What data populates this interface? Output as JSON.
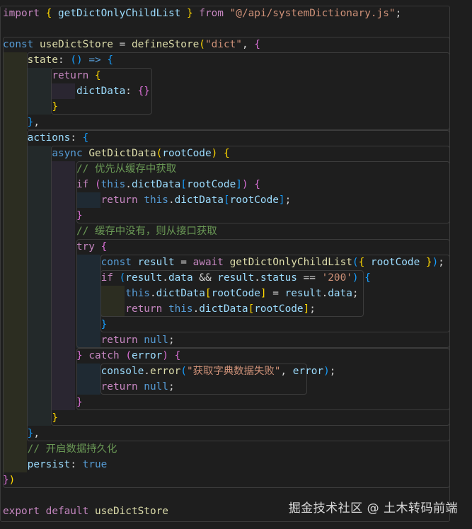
{
  "code": {
    "import_kw": "import",
    "import_name": "getDictOnlyChildList",
    "from_kw": "from",
    "import_path": "\"@/api/systemDictionary.js\"",
    "const_kw": "const",
    "store_name": "useDictStore",
    "define_fn": "defineStore",
    "store_id": "\"dict\"",
    "state_key": "state",
    "return_kw": "return",
    "dict_data_prop": "dictData",
    "actions_key": "actions",
    "async_kw": "async",
    "method_name": "GetDictData",
    "param_root_code": "rootCode",
    "comment_cache": "// 优先从缓存中获取",
    "if_kw": "if",
    "this_kw": "this",
    "comment_no_cache": "// 缓存中没有，则从接口获取",
    "try_kw": "try",
    "result_var": "result",
    "await_kw": "await",
    "data_prop": "data",
    "status_prop": "status",
    "status_value": "'200'",
    "null_kw": "null",
    "catch_kw": "catch",
    "error_var": "error",
    "console_obj": "console",
    "error_fn": "error",
    "error_message": "\"获取字典数据失败\"",
    "comment_persist": "// 开启数据持久化",
    "persist_key": "persist",
    "true_kw": "true",
    "export_kw": "export",
    "default_kw": "default"
  },
  "watermark": "掘金技术社区 @ 土木转码前端",
  "colors": {
    "background": "#1e1e1e",
    "keyword_control": "#c586c0",
    "keyword": "#569cd6",
    "function": "#dcdcaa",
    "variable": "#9cdcfe",
    "string": "#ce9178",
    "comment": "#6a9955",
    "bracket_1": "#ffd700",
    "bracket_2": "#da70d6",
    "bracket_3": "#179fff"
  }
}
